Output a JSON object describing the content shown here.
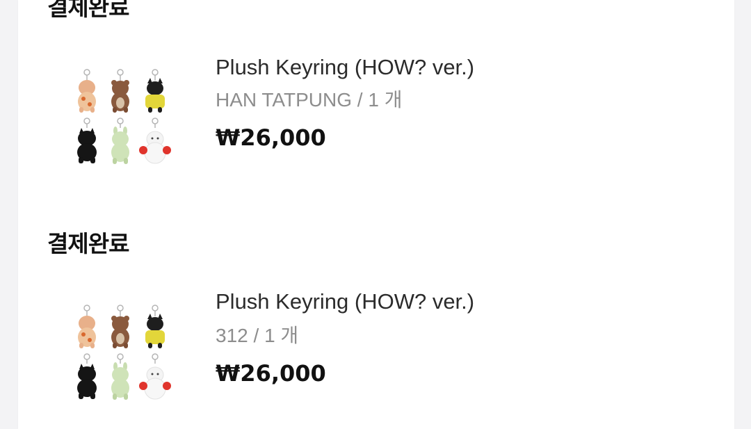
{
  "orders": [
    {
      "status": "결제완료",
      "product_name": "Plush Keyring (HOW? ver.)",
      "option": "HAN TATPUNG",
      "quantity": "1 개",
      "price": "₩26,000"
    },
    {
      "status": "결제완료",
      "product_name": "Plush Keyring (HOW? ver.)",
      "option": "312",
      "quantity": "1 개",
      "price": "₩26,000"
    }
  ],
  "meta_separator": " / ",
  "colors": {
    "background": "#f3f3f5",
    "card": "#ffffff",
    "text_primary": "#111111",
    "text_secondary": "#8d8d8d"
  }
}
